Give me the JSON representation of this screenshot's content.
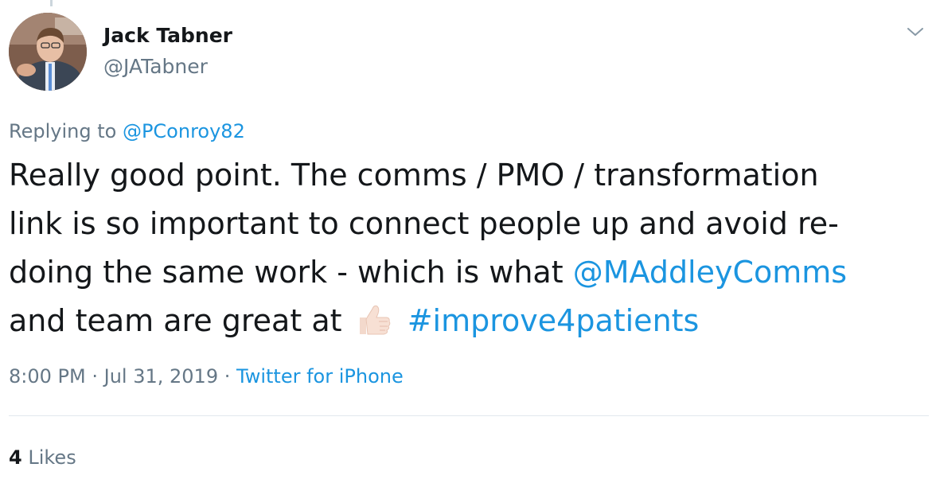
{
  "author": {
    "name": "Jack Tabner",
    "handle": "@JATabner"
  },
  "reply": {
    "prefix": "Replying to",
    "to": "@PConroy82"
  },
  "tweet": {
    "line1": "Really good point. The comms / PMO / transformation",
    "line2": "link is so important to connect people up and avoid re-",
    "line3_text": "doing the same work - which is what",
    "line3_mention": "@MAddleyComms",
    "line4_text": "and team are great at",
    "emoji": "thumbs-up-light-skin-tone",
    "hashtag": "#improve4patients"
  },
  "meta": {
    "time": "8:00 PM",
    "separator": "·",
    "date": "Jul 31, 2019",
    "source": "Twitter for iPhone"
  },
  "stats": {
    "likes_count": "4",
    "likes_label": "Likes"
  },
  "icons": {
    "caret": "chevron-down-icon",
    "avatar": "profile-photo"
  },
  "colors": {
    "link": "#1b95e0",
    "secondary_text": "#657786",
    "primary_text": "#14171a",
    "divider": "#e1e8ed"
  }
}
